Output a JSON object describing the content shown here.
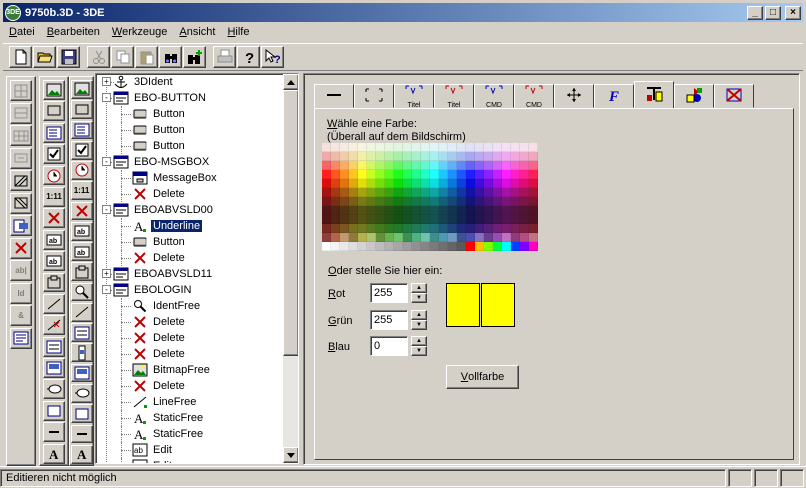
{
  "window": {
    "title": "9750b.3D - 3DE",
    "icon_text": "3DE"
  },
  "menu": {
    "items": [
      {
        "accel": "D",
        "rest": "atei"
      },
      {
        "accel": "B",
        "rest": "earbeiten"
      },
      {
        "accel": "W",
        "rest": "erkzeuge"
      },
      {
        "accel": "A",
        "rest": "nsicht"
      },
      {
        "accel": "H",
        "rest": "ilfe"
      }
    ]
  },
  "tree": {
    "nodes": [
      {
        "level": 0,
        "expander": "+",
        "icon": "anchor-icon",
        "label": "3DIdent"
      },
      {
        "level": 0,
        "expander": "-",
        "icon": "form-icon",
        "label": "EBO-BUTTON"
      },
      {
        "level": 1,
        "icon": "button-icon",
        "label": "Button"
      },
      {
        "level": 1,
        "icon": "button-icon",
        "label": "Button"
      },
      {
        "level": 1,
        "icon": "button-icon",
        "label": "Button"
      },
      {
        "level": 0,
        "expander": "-",
        "icon": "form-icon",
        "label": "EBO-MSGBOX"
      },
      {
        "level": 1,
        "icon": "messagebox-icon",
        "label": "MessageBox"
      },
      {
        "level": 1,
        "icon": "delete-icon",
        "label": "Delete"
      },
      {
        "level": 0,
        "expander": "-",
        "icon": "form-icon",
        "label": "EBOABVSLD00"
      },
      {
        "level": 1,
        "icon": "text-icon",
        "label": "Underline",
        "selected": true
      },
      {
        "level": 1,
        "icon": "button-icon",
        "label": "Button"
      },
      {
        "level": 1,
        "icon": "delete-icon",
        "label": "Delete"
      },
      {
        "level": 0,
        "expander": "+",
        "icon": "form-icon",
        "label": "EBOABVSLD11"
      },
      {
        "level": 0,
        "expander": "-",
        "icon": "form-icon",
        "label": "EBOLOGIN"
      },
      {
        "level": 1,
        "icon": "identfree-icon",
        "label": "IdentFree"
      },
      {
        "level": 1,
        "icon": "delete-icon",
        "label": "Delete"
      },
      {
        "level": 1,
        "icon": "delete-icon",
        "label": "Delete"
      },
      {
        "level": 1,
        "icon": "delete-icon",
        "label": "Delete"
      },
      {
        "level": 1,
        "icon": "bitmap-icon",
        "label": "BitmapFree"
      },
      {
        "level": 1,
        "icon": "delete-icon",
        "label": "Delete"
      },
      {
        "level": 1,
        "icon": "line-icon",
        "label": "LineFree"
      },
      {
        "level": 1,
        "icon": "text-icon",
        "label": "StaticFree"
      },
      {
        "level": 1,
        "icon": "text-icon",
        "label": "StaticFree"
      },
      {
        "level": 1,
        "icon": "edit-icon",
        "label": "Edit"
      },
      {
        "level": 1,
        "icon": "edit-icon",
        "label": "Edit"
      }
    ]
  },
  "tabs": {
    "items": [
      {
        "name": "line",
        "caption": ""
      },
      {
        "name": "frame",
        "caption": ""
      },
      {
        "name": "title-blue",
        "caption": "Titel"
      },
      {
        "name": "title-red",
        "caption": "Titel"
      },
      {
        "name": "cmd-blue",
        "caption": "CMD"
      },
      {
        "name": "cmd-red",
        "caption": "CMD"
      },
      {
        "name": "move",
        "caption": ""
      },
      {
        "name": "font",
        "caption": ""
      },
      {
        "name": "text-color",
        "caption": ""
      },
      {
        "name": "fill-color",
        "caption": ""
      },
      {
        "name": "no-color",
        "caption": ""
      }
    ]
  },
  "colorpage": {
    "prompt_accel": "W",
    "prompt_rest": "ähle eine Farbe:",
    "prompt_sub": "(Überall auf dem Bildschirm)",
    "custom_accel": "O",
    "custom_rest": "der stelle Sie hier ein:",
    "rot_accel": "R",
    "rot_rest": "ot",
    "rot_value": "255",
    "gruen_accel": "G",
    "gruen_rest": "rün",
    "gruen_value": "255",
    "blau_accel": "B",
    "blau_rest": "lau",
    "blau_value": "0",
    "vollfarbe_accel": "V",
    "vollfarbe_rest": "ollfarbe",
    "preview_color": "#ffff00"
  },
  "status": {
    "text": "Editieren nicht möglich"
  }
}
